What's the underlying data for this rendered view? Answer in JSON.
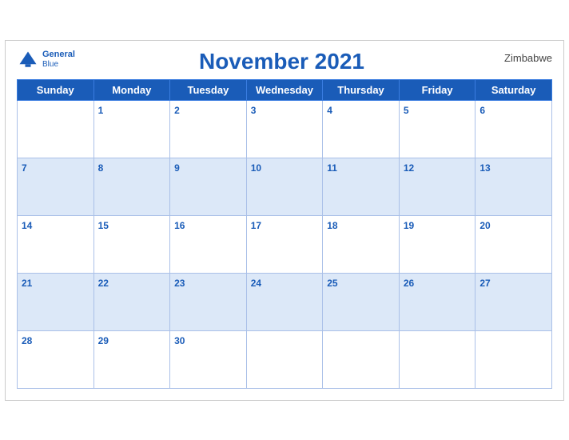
{
  "header": {
    "logo_general": "General",
    "logo_blue": "Blue",
    "month_title": "November 2021",
    "country": "Zimbabwe"
  },
  "weekdays": [
    "Sunday",
    "Monday",
    "Tuesday",
    "Wednesday",
    "Thursday",
    "Friday",
    "Saturday"
  ],
  "weeks": [
    [
      null,
      1,
      2,
      3,
      4,
      5,
      6
    ],
    [
      7,
      8,
      9,
      10,
      11,
      12,
      13
    ],
    [
      14,
      15,
      16,
      17,
      18,
      19,
      20
    ],
    [
      21,
      22,
      23,
      24,
      25,
      26,
      27
    ],
    [
      28,
      29,
      30,
      null,
      null,
      null,
      null
    ]
  ]
}
